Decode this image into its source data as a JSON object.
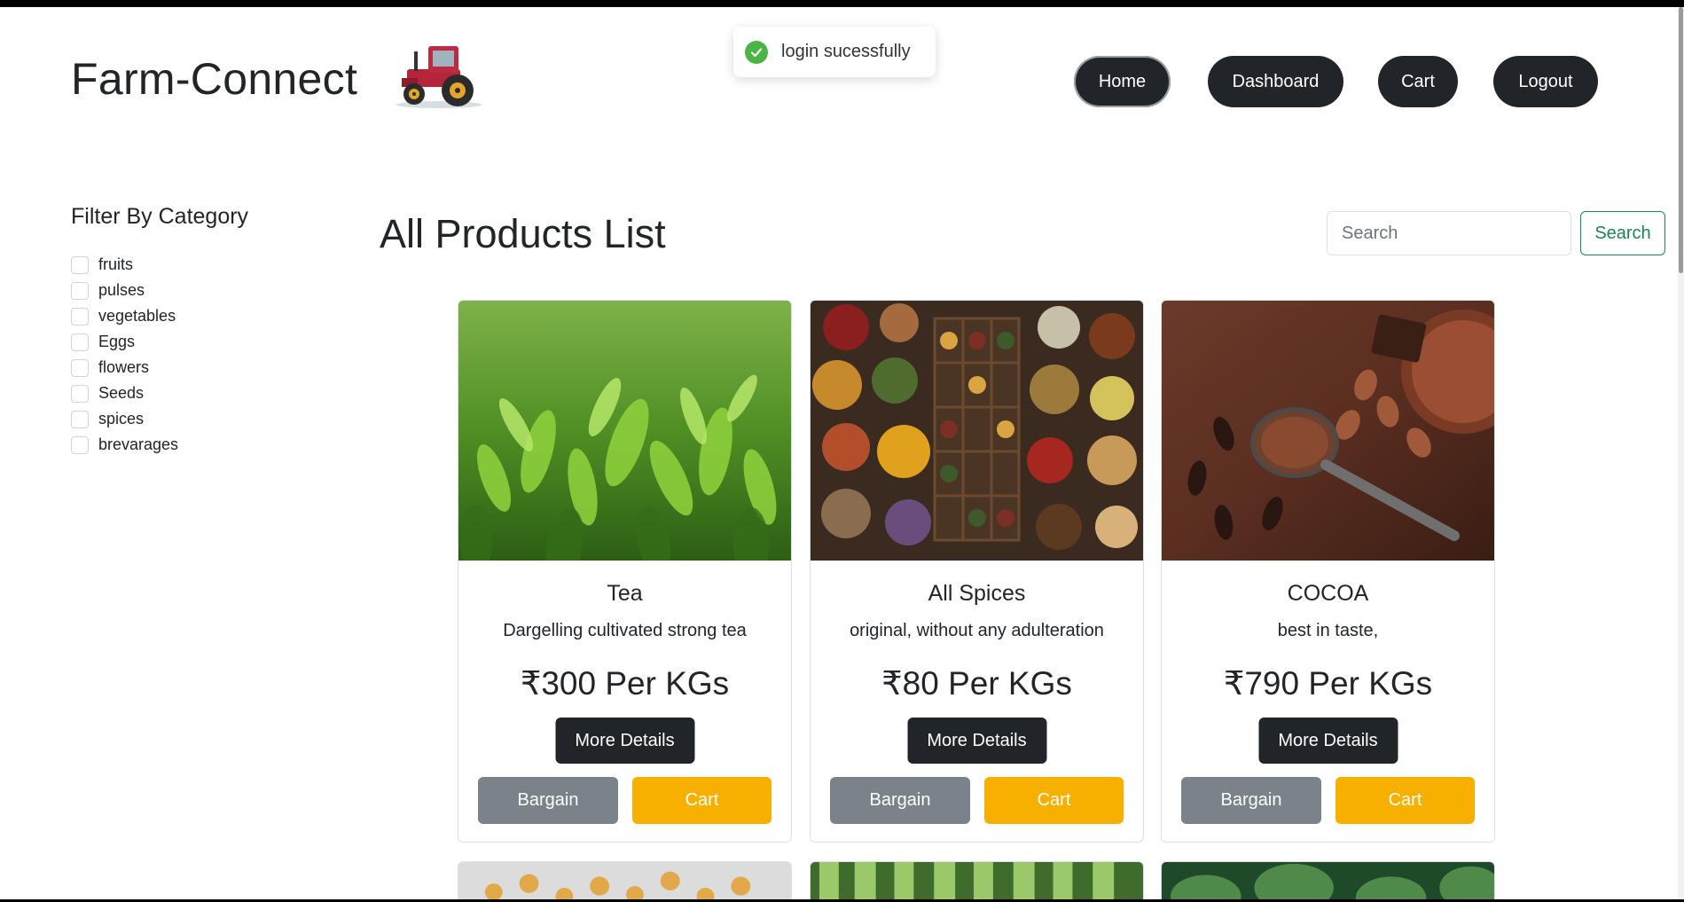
{
  "header": {
    "brand": "Farm-Connect",
    "nav": [
      "Home",
      "Dashboard",
      "Cart",
      "Logout"
    ]
  },
  "toast": {
    "message": "login sucessfully",
    "icon": "check-circle-icon"
  },
  "sidebar": {
    "title": "Filter By Category",
    "categories": [
      "fruits",
      "pulses",
      "vegetables",
      "Eggs",
      "flowers",
      "Seeds",
      "spices",
      "brevarages"
    ]
  },
  "main": {
    "title": "All Products List",
    "search": {
      "placeholder": "Search",
      "button": "Search"
    },
    "products": [
      {
        "name": "Tea",
        "description": "Dargelling cultivated strong tea",
        "price": "₹300 Per KGs",
        "image": "tea-leaves"
      },
      {
        "name": "All Spices",
        "description": "original, without any adulteration",
        "price": "₹80 Per KGs",
        "image": "spices"
      },
      {
        "name": "COCOA",
        "description": "best in taste,",
        "price": "₹790 Per KGs",
        "image": "cocoa"
      }
    ],
    "card_buttons": {
      "more": "More Details",
      "bargain": "Bargain",
      "cart": "Cart"
    }
  },
  "colors": {
    "dark": "#212529",
    "bargain": "#7a828a",
    "cart": "#f8b000",
    "search_green": "#198754",
    "toast_check": "#4bb543"
  }
}
